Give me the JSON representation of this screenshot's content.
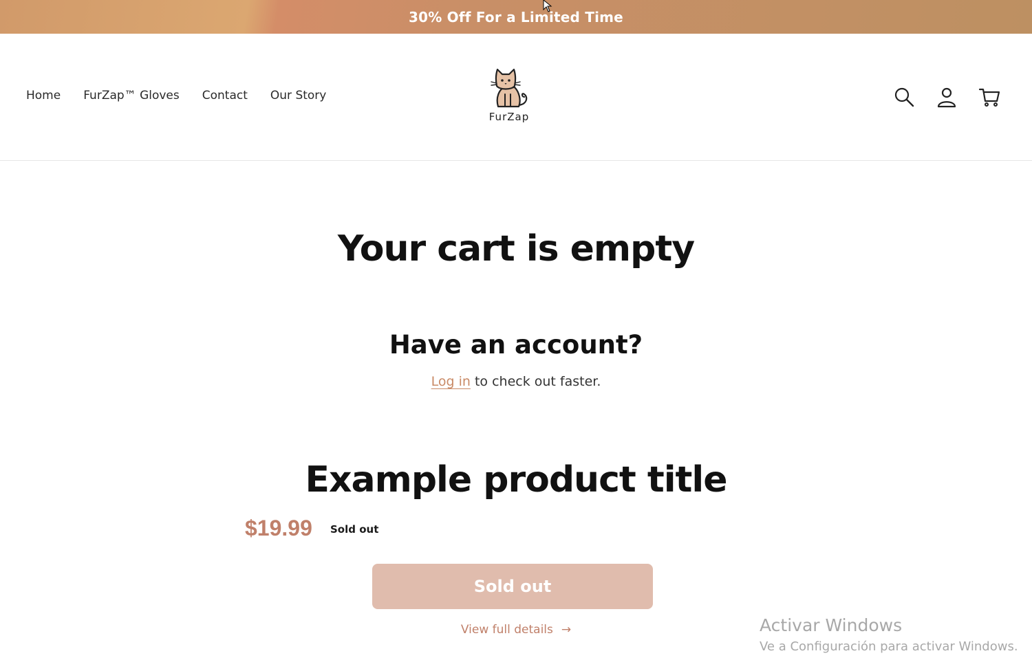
{
  "announcement": {
    "text": "30% Off For a Limited Time"
  },
  "nav": {
    "items": [
      {
        "label": "Home"
      },
      {
        "label": "FurZap™ Gloves"
      },
      {
        "label": "Contact"
      },
      {
        "label": "Our Story"
      }
    ]
  },
  "logo": {
    "text": "FurZap",
    "icon": "cat-logo-icon"
  },
  "header_icons": [
    "search-icon",
    "account-icon",
    "cart-icon"
  ],
  "cart": {
    "title": "Your cart is empty",
    "account_title": "Have an account?",
    "login_link": "Log in",
    "login_suffix": " to check out faster."
  },
  "product": {
    "title": "Example product title",
    "price": "$19.99",
    "badge": "Sold out",
    "button_label": "Sold out",
    "details_link": "View full details",
    "details_arrow": "→"
  },
  "watermark": {
    "line1": "Activar Windows",
    "line2": "Ve a Configuración para activar Windows."
  },
  "colors": {
    "accent": "#c0806a",
    "button_disabled": "#e0bcad",
    "banner": "#c98f67"
  }
}
